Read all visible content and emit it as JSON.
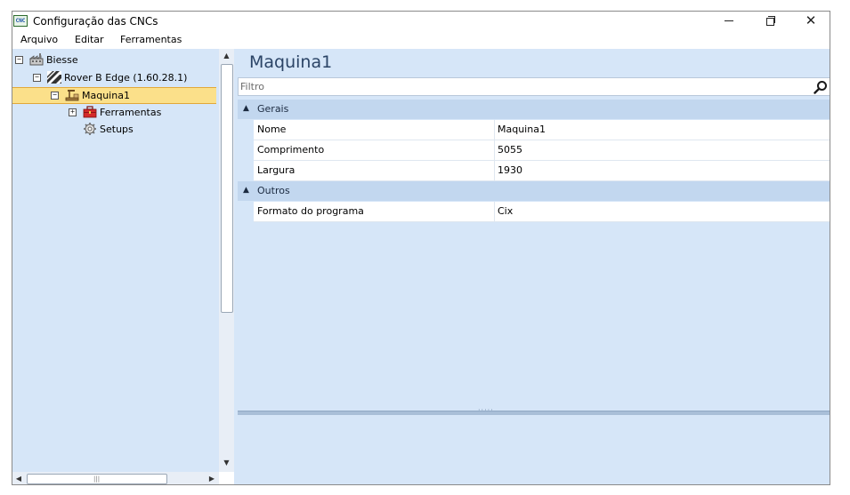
{
  "window": {
    "title": "Configuração das CNCs",
    "app_icon_text": "CNC",
    "minimize": "–",
    "close": "✕"
  },
  "menu": {
    "items": [
      "Arquivo",
      "Editar",
      "Ferramentas"
    ]
  },
  "tree": {
    "nodes": [
      {
        "label": "Biesse",
        "expander": "−",
        "icon": "factory-icon"
      },
      {
        "label": "Rover B Edge (1.60.28.1)",
        "expander": "−",
        "icon": "striped-machine-icon"
      },
      {
        "label": "Maquina1",
        "expander": "−",
        "icon": "machine-icon",
        "selected": true
      },
      {
        "label": "Ferramentas",
        "expander": "+",
        "icon": "toolbox-icon"
      },
      {
        "label": "Setups",
        "expander": "",
        "icon": "gear-icon"
      }
    ]
  },
  "scrollbars": {
    "up": "▲",
    "down": "▼",
    "left": "◀",
    "right": "▶",
    "h_grip": "|||"
  },
  "props": {
    "title": "Maquina1",
    "filter_placeholder": "Filtro",
    "categories": [
      {
        "name": "Gerais",
        "caret": "▲",
        "rows": [
          {
            "name": "Nome",
            "value": "Maquina1"
          },
          {
            "name": "Comprimento",
            "value": "5055"
          },
          {
            "name": "Largura",
            "value": "1930"
          }
        ]
      },
      {
        "name": "Outros",
        "caret": "▲",
        "rows": [
          {
            "name": "Formato do programa",
            "value": "Cix"
          }
        ]
      }
    ],
    "splitter_dots": "·····"
  },
  "colors": {
    "pane_background": "#d6e6f8",
    "selection": "#fbe08a",
    "title_text": "#2b4466"
  }
}
